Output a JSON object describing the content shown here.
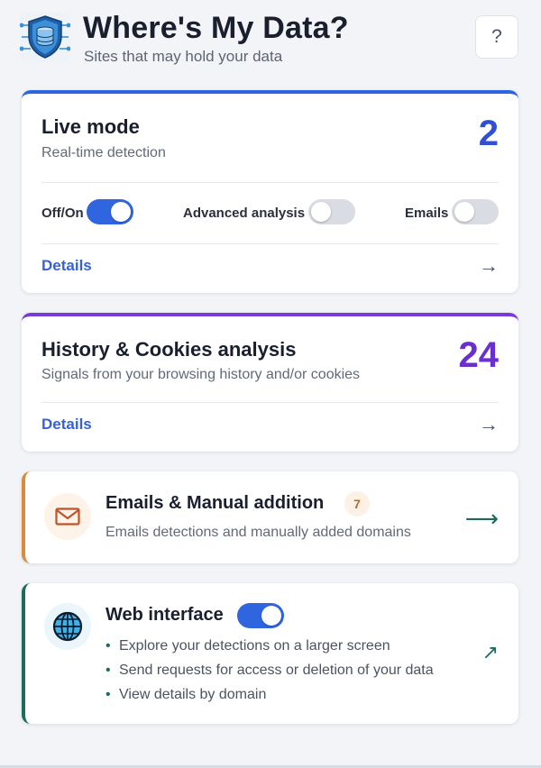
{
  "header": {
    "title": "Where's My Data?",
    "subtitle": "Sites that may hold your data",
    "help_label": "?"
  },
  "live_mode": {
    "title": "Live mode",
    "subtitle": "Real-time detection",
    "count": "2",
    "toggles": [
      {
        "label": "Off/On",
        "state": "on"
      },
      {
        "label": "Advanced analysis",
        "state": "off"
      },
      {
        "label": "Emails",
        "state": "off"
      }
    ],
    "details_label": "Details",
    "arrow": "→"
  },
  "history": {
    "title": "History & Cookies analysis",
    "subtitle": "Signals from your browsing history and/or cookies",
    "count": "24",
    "details_label": "Details",
    "arrow": "→"
  },
  "emails": {
    "title": "Emails & Manual addition",
    "badge": "7",
    "subtitle": "Emails detections and manually added domains",
    "icon": "mail-icon",
    "arrow": "⟶"
  },
  "web_interface": {
    "title": "Web interface",
    "toggle_state": "on",
    "icon": "globe-icon",
    "bullets": [
      "Explore your detections on a larger screen",
      "Send requests for access or deletion of your data",
      "View details by domain"
    ],
    "arrow": "↗"
  },
  "colors": {
    "accent_blue": "#2f66e0",
    "accent_purple": "#7a3ad9",
    "accent_orange": "#d98a3a",
    "accent_teal": "#1c6b5e"
  }
}
